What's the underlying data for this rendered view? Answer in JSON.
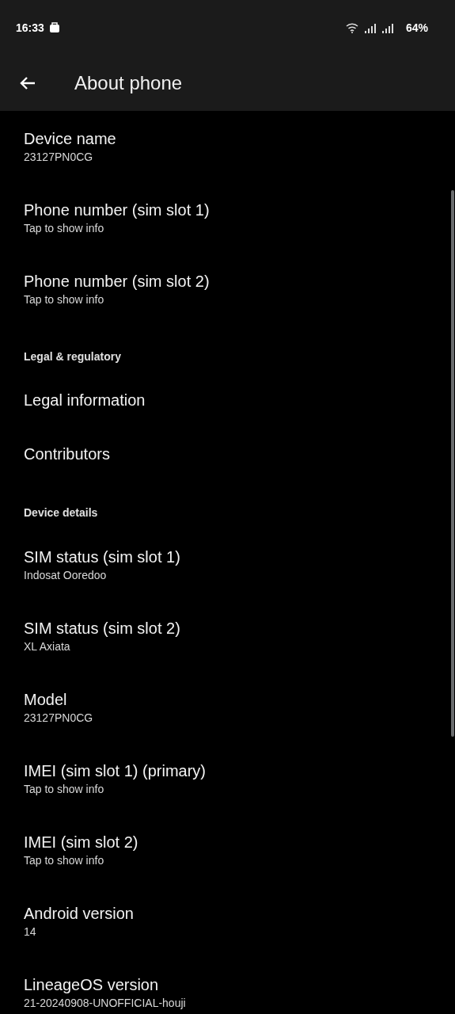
{
  "status_bar": {
    "time": "16:33",
    "battery": "64%"
  },
  "app_bar": {
    "title": "About phone"
  },
  "items": [
    {
      "kind": "item",
      "title": "Device name",
      "summary": "23127PN0CG"
    },
    {
      "kind": "item",
      "title": "Phone number (sim slot 1)",
      "summary": "Tap to show info"
    },
    {
      "kind": "item",
      "title": "Phone number (sim slot 2)",
      "summary": "Tap to show info"
    },
    {
      "kind": "header",
      "title": "Legal & regulatory"
    },
    {
      "kind": "item",
      "title": "Legal information"
    },
    {
      "kind": "item",
      "title": "Contributors"
    },
    {
      "kind": "header",
      "title": "Device details"
    },
    {
      "kind": "item",
      "title": "SIM status (sim slot 1)",
      "summary": "Indosat Ooredoo"
    },
    {
      "kind": "item",
      "title": "SIM status (sim slot 2)",
      "summary": "XL Axiata"
    },
    {
      "kind": "item",
      "title": "Model",
      "summary": "23127PN0CG"
    },
    {
      "kind": "item",
      "title": "IMEI (sim slot 1) (primary)",
      "summary": "Tap to show info"
    },
    {
      "kind": "item",
      "title": "IMEI (sim slot 2)",
      "summary": "Tap to show info"
    },
    {
      "kind": "item",
      "title": "Android version",
      "summary": "14"
    },
    {
      "kind": "item",
      "title": "LineageOS version",
      "summary": "21-20240908-UNOFFICIAL-houji"
    }
  ]
}
